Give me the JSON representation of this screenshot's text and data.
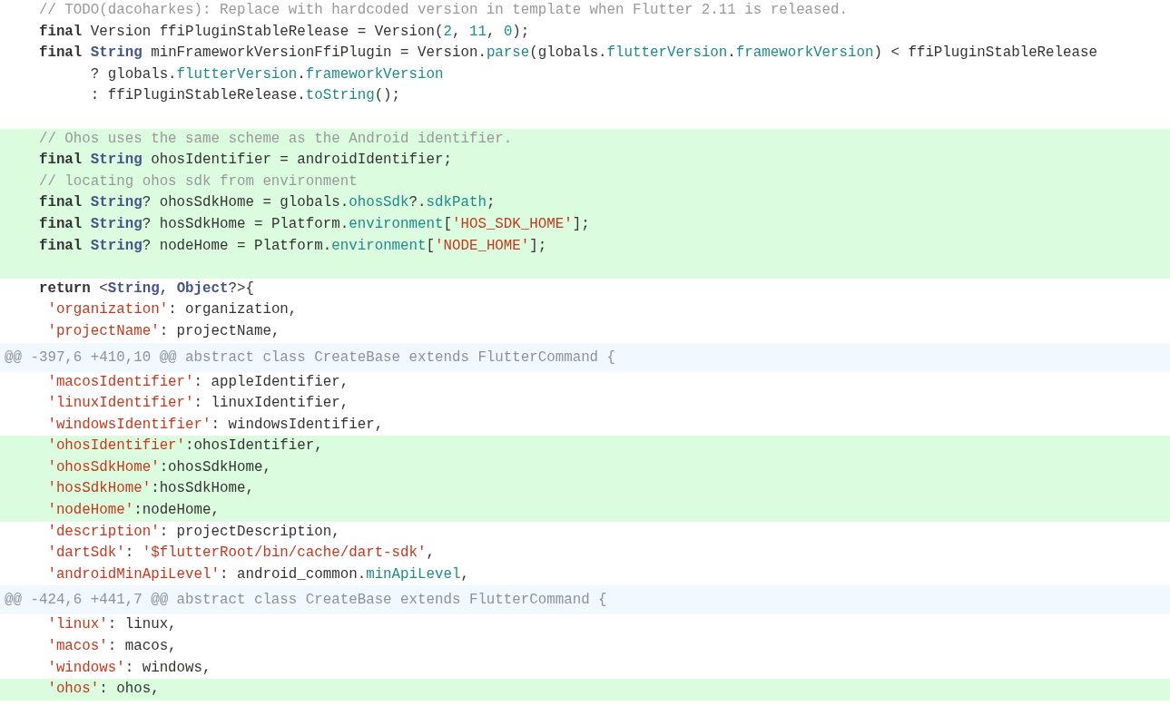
{
  "diff": {
    "lines": [
      {
        "kind": "context",
        "tokens": [
          {
            "kind": "comment",
            "text": "    // TODO(dacoharkes): Replace with hardcoded version in template when Flutter 2.11 is released."
          }
        ]
      },
      {
        "kind": "context",
        "tokens": [
          {
            "kind": "keyword",
            "text": "    final"
          },
          {
            "kind": "plain",
            "text": " Version ffiPluginStableRelease = Version("
          },
          {
            "kind": "number",
            "text": "2"
          },
          {
            "kind": "plain",
            "text": ", "
          },
          {
            "kind": "number",
            "text": "11"
          },
          {
            "kind": "plain",
            "text": ", "
          },
          {
            "kind": "number",
            "text": "0"
          },
          {
            "kind": "plain",
            "text": ");"
          }
        ]
      },
      {
        "kind": "context",
        "tokens": [
          {
            "kind": "keyword",
            "text": "    final "
          },
          {
            "kind": "type",
            "text": "String"
          },
          {
            "kind": "plain",
            "text": " minFrameworkVersionFfiPlugin = Version."
          },
          {
            "kind": "member",
            "text": "parse"
          },
          {
            "kind": "plain",
            "text": "(globals."
          },
          {
            "kind": "member",
            "text": "flutterVersion"
          },
          {
            "kind": "plain",
            "text": "."
          },
          {
            "kind": "member",
            "text": "frameworkVersion"
          },
          {
            "kind": "plain",
            "text": ") < ffiPluginStableRelease"
          }
        ]
      },
      {
        "kind": "context",
        "tokens": [
          {
            "kind": "plain",
            "text": "          ? globals."
          },
          {
            "kind": "member",
            "text": "flutterVersion"
          },
          {
            "kind": "plain",
            "text": "."
          },
          {
            "kind": "member",
            "text": "frameworkVersion"
          }
        ]
      },
      {
        "kind": "context",
        "tokens": [
          {
            "kind": "plain",
            "text": "          : ffiPluginStableRelease."
          },
          {
            "kind": "member",
            "text": "toString"
          },
          {
            "kind": "plain",
            "text": "();"
          }
        ]
      },
      {
        "kind": "context"
      },
      {
        "kind": "added",
        "tokens": [
          {
            "kind": "comment",
            "text": "    // Ohos uses the same scheme as the Android identifier."
          }
        ]
      },
      {
        "kind": "added",
        "tokens": [
          {
            "kind": "keyword",
            "text": "    final "
          },
          {
            "kind": "type",
            "text": "String"
          },
          {
            "kind": "plain",
            "text": " ohosIdentifier = androidIdentifier;"
          }
        ]
      },
      {
        "kind": "added",
        "tokens": [
          {
            "kind": "comment",
            "text": "    // locating ohos sdk from environment"
          }
        ]
      },
      {
        "kind": "added",
        "tokens": [
          {
            "kind": "keyword",
            "text": "    final "
          },
          {
            "kind": "type",
            "text": "String"
          },
          {
            "kind": "plain",
            "text": "? ohosSdkHome = globals."
          },
          {
            "kind": "member",
            "text": "ohosSdk"
          },
          {
            "kind": "plain",
            "text": "?."
          },
          {
            "kind": "member",
            "text": "sdkPath"
          },
          {
            "kind": "plain",
            "text": ";"
          }
        ]
      },
      {
        "kind": "added",
        "tokens": [
          {
            "kind": "keyword",
            "text": "    final "
          },
          {
            "kind": "type",
            "text": "String"
          },
          {
            "kind": "plain",
            "text": "? hosSdkHome = Platform."
          },
          {
            "kind": "member",
            "text": "environment"
          },
          {
            "kind": "plain",
            "text": "["
          },
          {
            "kind": "string",
            "text": "'HOS_SDK_HOME'"
          },
          {
            "kind": "plain",
            "text": "];"
          }
        ]
      },
      {
        "kind": "added",
        "tokens": [
          {
            "kind": "keyword",
            "text": "    final "
          },
          {
            "kind": "type",
            "text": "String"
          },
          {
            "kind": "plain",
            "text": "? nodeHome = Platform."
          },
          {
            "kind": "member",
            "text": "environment"
          },
          {
            "kind": "plain",
            "text": "["
          },
          {
            "kind": "string",
            "text": "'NODE_HOME'"
          },
          {
            "kind": "plain",
            "text": "];"
          }
        ]
      },
      {
        "kind": "added"
      },
      {
        "kind": "context",
        "tokens": [
          {
            "kind": "keyword",
            "text": "    return"
          },
          {
            "kind": "plain",
            "text": " <"
          },
          {
            "kind": "type",
            "text": "String"
          },
          {
            "kind": "plain",
            "text": ", "
          },
          {
            "kind": "type",
            "text": "Object"
          },
          {
            "kind": "plain",
            "text": "?>{"
          }
        ]
      },
      {
        "kind": "context",
        "tokens": [
          {
            "kind": "string",
            "text": "     'organization'"
          },
          {
            "kind": "plain",
            "text": ": organization,"
          }
        ]
      },
      {
        "kind": "context",
        "tokens": [
          {
            "kind": "string",
            "text": "     'projectName'"
          },
          {
            "kind": "plain",
            "text": ": projectName,"
          }
        ]
      },
      {
        "kind": "hunk",
        "tokens": [
          {
            "kind": "plain",
            "text": "@@ -397,6 +410,10 @@ abstract class CreateBase extends FlutterCommand {"
          }
        ]
      },
      {
        "kind": "context",
        "tokens": [
          {
            "kind": "string",
            "text": "     'macosIdentifier'"
          },
          {
            "kind": "plain",
            "text": ": appleIdentifier,"
          }
        ]
      },
      {
        "kind": "context",
        "tokens": [
          {
            "kind": "string",
            "text": "     'linuxIdentifier'"
          },
          {
            "kind": "plain",
            "text": ": linuxIdentifier,"
          }
        ]
      },
      {
        "kind": "context",
        "tokens": [
          {
            "kind": "string",
            "text": "     'windowsIdentifier'"
          },
          {
            "kind": "plain",
            "text": ": windowsIdentifier,"
          }
        ]
      },
      {
        "kind": "added",
        "tokens": [
          {
            "kind": "string",
            "text": "     'ohosIdentifier'"
          },
          {
            "kind": "plain",
            "text": ":ohosIdentifier,"
          }
        ]
      },
      {
        "kind": "added",
        "tokens": [
          {
            "kind": "string",
            "text": "     'ohosSdkHome'"
          },
          {
            "kind": "plain",
            "text": ":ohosSdkHome,"
          }
        ]
      },
      {
        "kind": "added",
        "tokens": [
          {
            "kind": "string",
            "text": "     'hosSdkHome'"
          },
          {
            "kind": "plain",
            "text": ":hosSdkHome,"
          }
        ]
      },
      {
        "kind": "added",
        "tokens": [
          {
            "kind": "string",
            "text": "     'nodeHome'"
          },
          {
            "kind": "plain",
            "text": ":nodeHome,"
          }
        ]
      },
      {
        "kind": "context",
        "tokens": [
          {
            "kind": "string",
            "text": "     'description'"
          },
          {
            "kind": "plain",
            "text": ": projectDescription,"
          }
        ]
      },
      {
        "kind": "context",
        "tokens": [
          {
            "kind": "string",
            "text": "     'dartSdk'"
          },
          {
            "kind": "plain",
            "text": ": "
          },
          {
            "kind": "string",
            "text": "'$flutterRoot/bin/cache/dart-sdk'"
          },
          {
            "kind": "plain",
            "text": ","
          }
        ]
      },
      {
        "kind": "context",
        "tokens": [
          {
            "kind": "string",
            "text": "     'androidMinApiLevel'"
          },
          {
            "kind": "plain",
            "text": ": android_common."
          },
          {
            "kind": "member",
            "text": "minApiLevel"
          },
          {
            "kind": "plain",
            "text": ","
          }
        ]
      },
      {
        "kind": "hunk",
        "tokens": [
          {
            "kind": "plain",
            "text": "@@ -424,6 +441,7 @@ abstract class CreateBase extends FlutterCommand {"
          }
        ]
      },
      {
        "kind": "context",
        "tokens": [
          {
            "kind": "string",
            "text": "     'linux'"
          },
          {
            "kind": "plain",
            "text": ": linux,"
          }
        ]
      },
      {
        "kind": "context",
        "tokens": [
          {
            "kind": "string",
            "text": "     'macos'"
          },
          {
            "kind": "plain",
            "text": ": macos,"
          }
        ]
      },
      {
        "kind": "context",
        "tokens": [
          {
            "kind": "string",
            "text": "     'windows'"
          },
          {
            "kind": "plain",
            "text": ": windows,"
          }
        ]
      },
      {
        "kind": "added",
        "tokens": [
          {
            "kind": "string",
            "text": "     'ohos'"
          },
          {
            "kind": "plain",
            "text": ": ohos,"
          }
        ]
      }
    ]
  }
}
